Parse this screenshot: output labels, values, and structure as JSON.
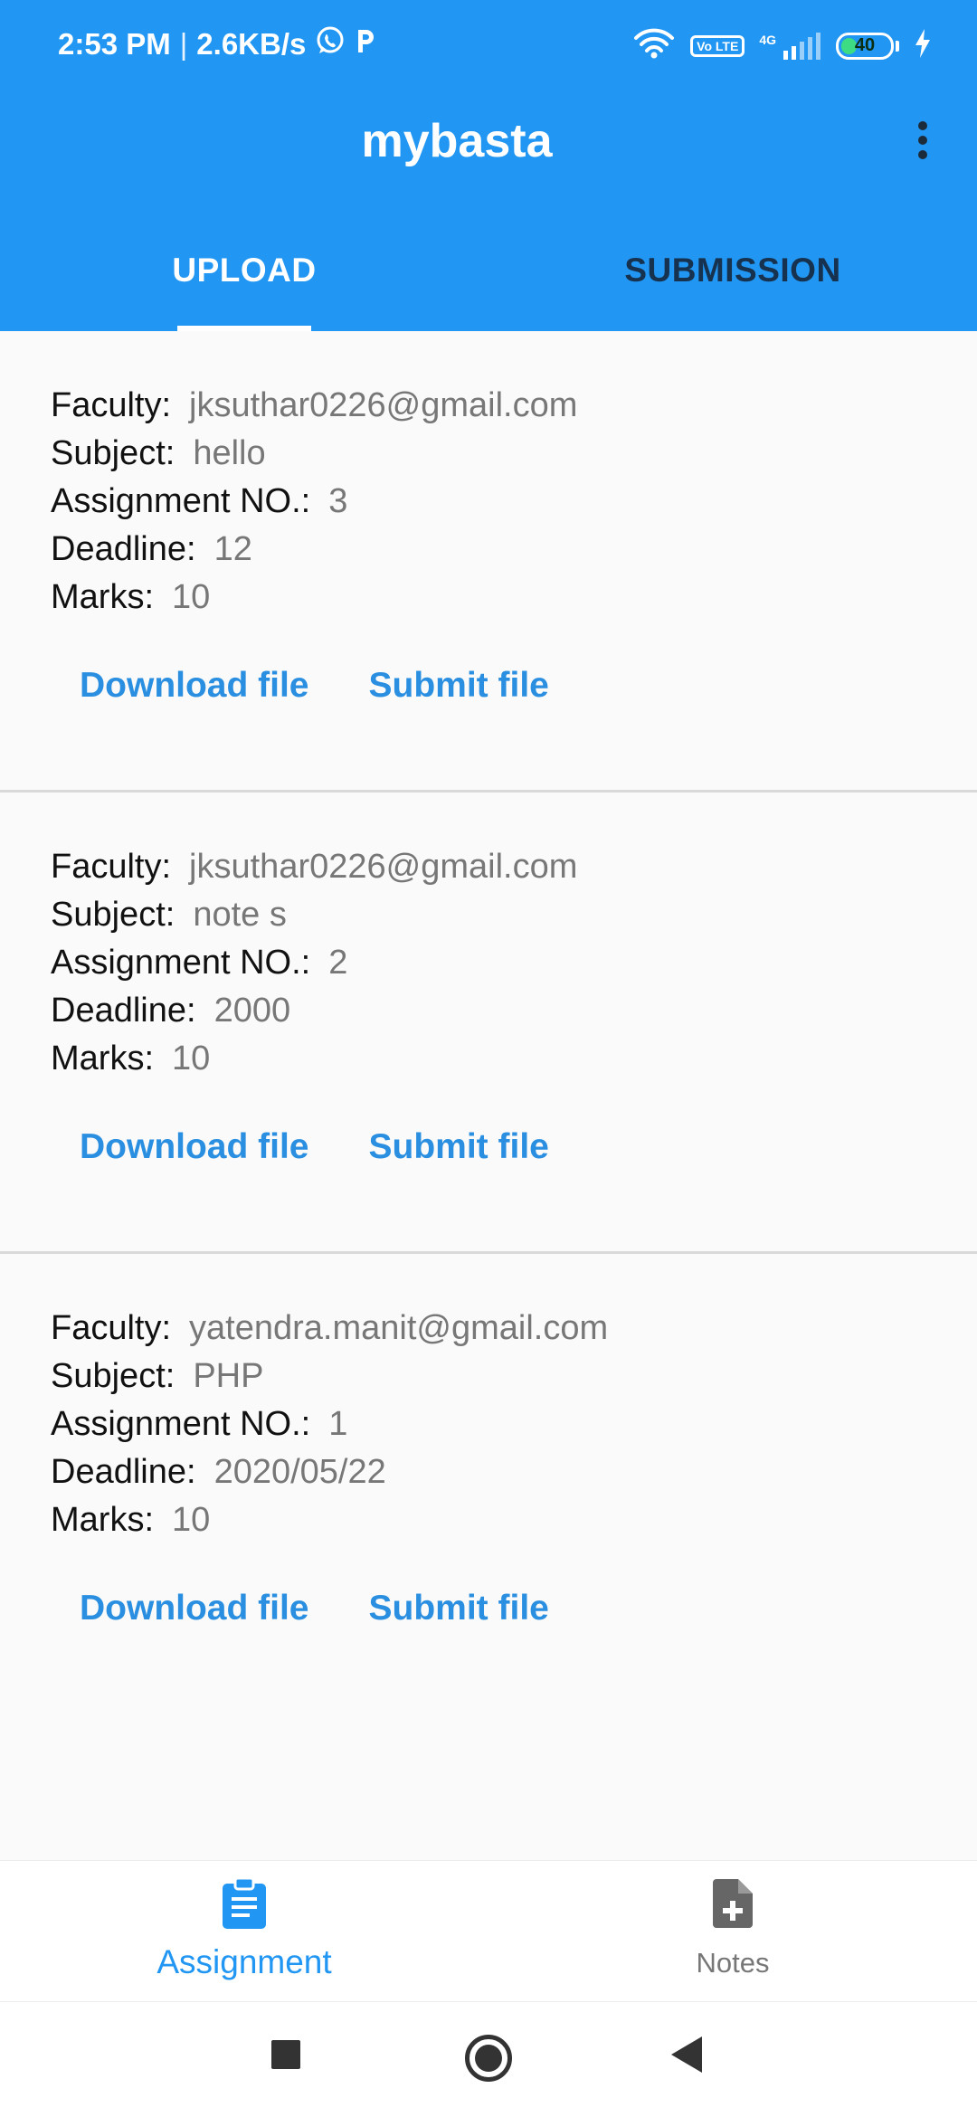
{
  "status_bar": {
    "time": "2:53 PM",
    "separator": "|",
    "net_speed": "2.6KB/s",
    "left_icons": [
      "whatsapp-icon",
      "parking-p-icon"
    ],
    "volte_label": "Vo LTE",
    "network_type": "4G",
    "battery_percent": "40",
    "battery_level": 0.4
  },
  "app_bar": {
    "title": "mybasta"
  },
  "tabs": [
    {
      "label": "UPLOAD",
      "active": true
    },
    {
      "label": "SUBMISSION",
      "active": false
    }
  ],
  "labels": {
    "faculty": "Faculty:",
    "subject": "Subject:",
    "assignment_no": "Assignment NO.:",
    "deadline": "Deadline:",
    "marks": "Marks:"
  },
  "assignments": [
    {
      "faculty": "jksuthar0226@gmail.com",
      "subject": "hello",
      "assignment_no": "3",
      "deadline": "12",
      "marks": "10",
      "download_label": "Download file",
      "submit_label": "Submit file"
    },
    {
      "faculty": "jksuthar0226@gmail.com",
      "subject": "note s",
      "assignment_no": "2",
      "deadline": "2000",
      "marks": "10",
      "download_label": "Download file",
      "submit_label": "Submit file"
    },
    {
      "faculty": "yatendra.manit@gmail.com",
      "subject": "PHP",
      "assignment_no": "1",
      "deadline": "2020/05/22",
      "marks": "10",
      "download_label": "Download file",
      "submit_label": "Submit file"
    }
  ],
  "bottom_nav": [
    {
      "label": "Assignment",
      "icon": "clipboard-icon",
      "active": true
    },
    {
      "label": "Notes",
      "icon": "note-add-icon",
      "active": false
    }
  ],
  "colors": {
    "primary": "#2196F3",
    "inactive_tab_text": "#17324f",
    "link": "#2a8fe0",
    "value_text": "#777777"
  }
}
